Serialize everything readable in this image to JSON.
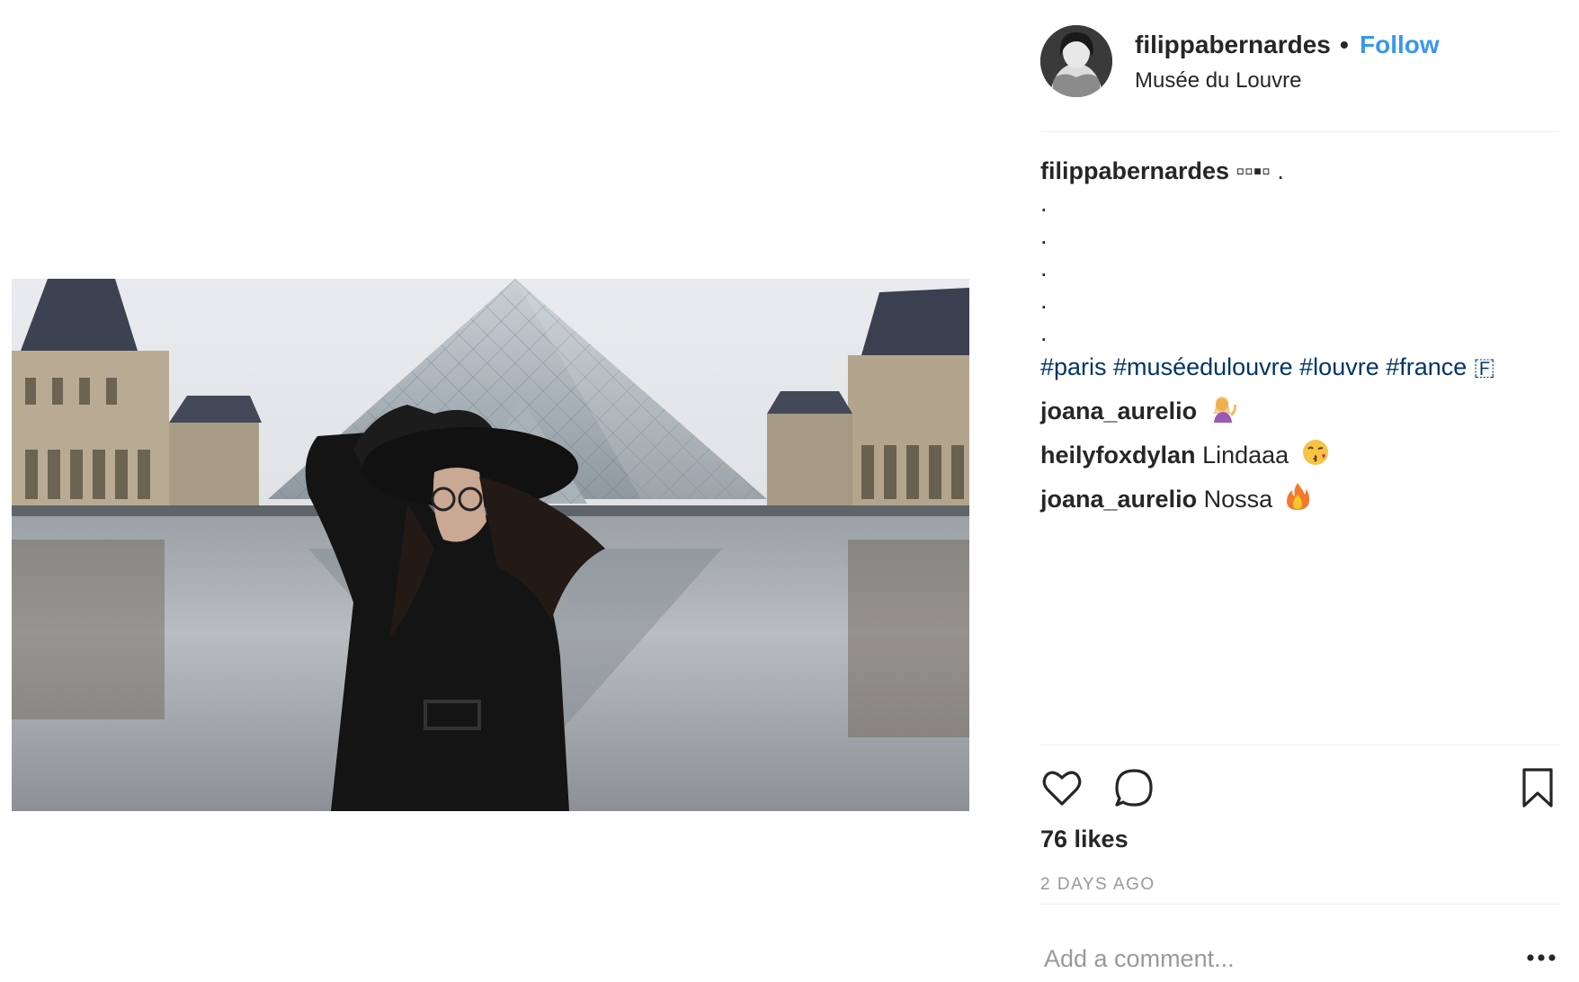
{
  "post": {
    "photo_alt": "Photo of a woman in a black hat in front of the Louvre pyramid"
  },
  "header": {
    "username": "filippabernardes",
    "separator": "•",
    "follow_label": "Follow",
    "location": "Musée du Louvre"
  },
  "caption": {
    "username": "filippabernardes",
    "text": "▫▫▪▫ .",
    "dots": [
      ".",
      ".",
      ".",
      ".",
      "."
    ],
    "hashtags": "#paris #muséedulouvre #louvre #france 🇫"
  },
  "comments": [
    {
      "username": "joana_aurelio",
      "text": "",
      "emoji": "raising-hand-woman"
    },
    {
      "username": "heilyfoxdylan",
      "text": "Lindaaa",
      "emoji": "kissing-face"
    },
    {
      "username": "joana_aurelio",
      "text": "Nossa",
      "emoji": "fire"
    }
  ],
  "actions": {
    "like_icon": "heart-icon",
    "comment_icon": "comment-icon",
    "save_icon": "bookmark-icon"
  },
  "likes": "76 likes",
  "timestamp": "2 DAYS AGO",
  "comment_box": {
    "placeholder": "Add a comment...",
    "more_icon": "more-options-icon"
  },
  "colors": {
    "follow": "#3897f0",
    "hashtag": "#003569",
    "muted": "#999999",
    "text": "#262626"
  }
}
